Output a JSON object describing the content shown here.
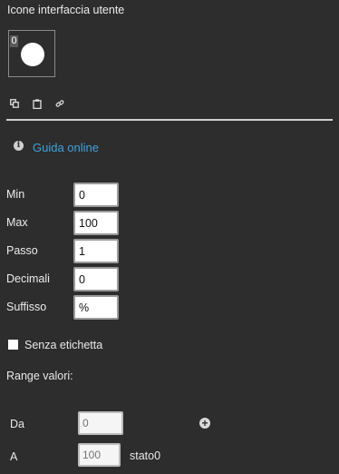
{
  "panel": {
    "title": "Icone interfaccia utente"
  },
  "icon_slot": {
    "index": "0"
  },
  "toolbar": {
    "copy_icon": "copy-icon",
    "paste_icon": "clipboard-icon",
    "link_icon": "link-icon"
  },
  "help": {
    "label": "Guida online",
    "icon": "info-icon"
  },
  "fields": {
    "min": {
      "label": "Min",
      "value": "0"
    },
    "max": {
      "label": "Max",
      "value": "100"
    },
    "step": {
      "label": "Passo",
      "value": "1"
    },
    "decimals": {
      "label": "Decimali",
      "value": "0"
    },
    "suffix": {
      "label": "Suffisso",
      "value": "%"
    }
  },
  "no_label": {
    "label": "Senza etichetta",
    "checked": false
  },
  "range": {
    "title": "Range valori:",
    "from": {
      "label": "Da",
      "placeholder": "0"
    },
    "to": {
      "label": "A",
      "placeholder": "100",
      "state": "stato0"
    }
  },
  "colors": {
    "background": "#2d2d2d",
    "link": "#3ea3dc",
    "text": "#ececec"
  }
}
